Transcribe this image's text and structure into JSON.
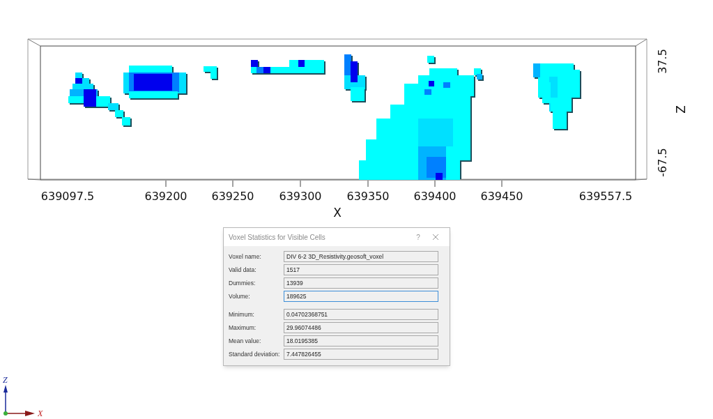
{
  "plot": {
    "x_axis": {
      "title": "X",
      "ticks": [
        "639097.5",
        "639200",
        "639250",
        "639300",
        "639350",
        "639400",
        "639450",
        "639557.5"
      ]
    },
    "z_axis": {
      "title": "Z",
      "ticks": [
        "37.5",
        "-67.5"
      ]
    }
  },
  "triad": {
    "z_label": "Z",
    "x_label": "X"
  },
  "dialog": {
    "title": "Voxel Statistics for Visible Cells",
    "help": "?",
    "groups": [
      [
        {
          "label": "Voxel name:",
          "value": "DIV 6-2 3D_Resistivity.geosoft_voxel",
          "focused": false
        },
        {
          "label": "Valid data:",
          "value": "1517",
          "focused": false
        },
        {
          "label": "Dummies:",
          "value": "13939",
          "focused": false
        },
        {
          "label": "Volume:",
          "value": "189625",
          "focused": true
        }
      ],
      [
        {
          "label": "Minimum:",
          "value": "0.04702368751",
          "focused": false
        },
        {
          "label": "Maximum:",
          "value": "29.96074486",
          "focused": false
        },
        {
          "label": "Mean value:",
          "value": "18.0195385",
          "focused": false
        },
        {
          "label": "Standard deviation:",
          "value": "7.447826455",
          "focused": false
        }
      ]
    ]
  }
}
